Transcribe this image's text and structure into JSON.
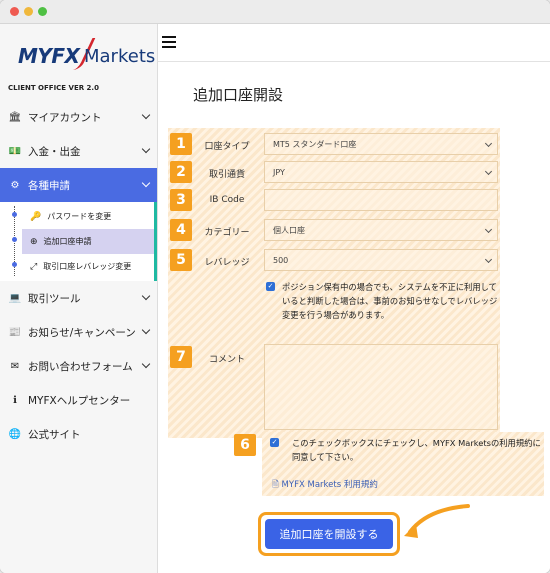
{
  "sidebar": {
    "logo_brand": "MYFX",
    "logo_sub": "Markets",
    "version": "CLIENT OFFICE VER 2.0",
    "items": [
      {
        "label": "マイアカウント",
        "icon": "bank-icon"
      },
      {
        "label": "入金・出金",
        "icon": "money-icon"
      },
      {
        "label": "各種申請",
        "icon": "gears-icon"
      },
      {
        "label": "取引ツール",
        "icon": "laptop-icon"
      },
      {
        "label": "お知らせ/キャンペーン",
        "icon": "newspaper-icon"
      },
      {
        "label": "お問い合わせフォーム",
        "icon": "envelope-icon"
      },
      {
        "label": "MYFXヘルプセンター",
        "icon": "info-icon"
      },
      {
        "label": "公式サイト",
        "icon": "globe-icon"
      }
    ],
    "subitems": [
      {
        "label": "パスワードを変更",
        "icon": "key-icon"
      },
      {
        "label": "追加口座申請",
        "icon": "plus-circle-icon"
      },
      {
        "label": "取引口座レバレッジ変更",
        "icon": "expand-icon"
      }
    ]
  },
  "main": {
    "title": "追加口座開設",
    "fields": [
      {
        "num": "1",
        "label": "口座タイプ",
        "value": "MT5 スタンダード口座"
      },
      {
        "num": "2",
        "label": "取引通貨",
        "value": "JPY"
      },
      {
        "num": "3",
        "label": "IB Code",
        "value": ""
      },
      {
        "num": "4",
        "label": "カテゴリー",
        "value": "個人口座"
      },
      {
        "num": "5",
        "label": "レバレッジ",
        "value": "500"
      }
    ],
    "leverage_note": "ポジション保有中の場合でも、システムを不正に利用していると判断した場合は、事前のお知らせなしでレバレッジ変更を行う場合があります。",
    "comment_num": "7",
    "comment_label": "コメント",
    "agree_num": "6",
    "agree_text": "このチェックボックスにチェックし、MYFX Marketsの利用規約に同意して下さい。",
    "terms_link": "MYFX Markets 利用規約",
    "submit": "追加口座を開設する"
  },
  "colors": {
    "accent": "#f5a020",
    "primary": "#3a63e6"
  }
}
